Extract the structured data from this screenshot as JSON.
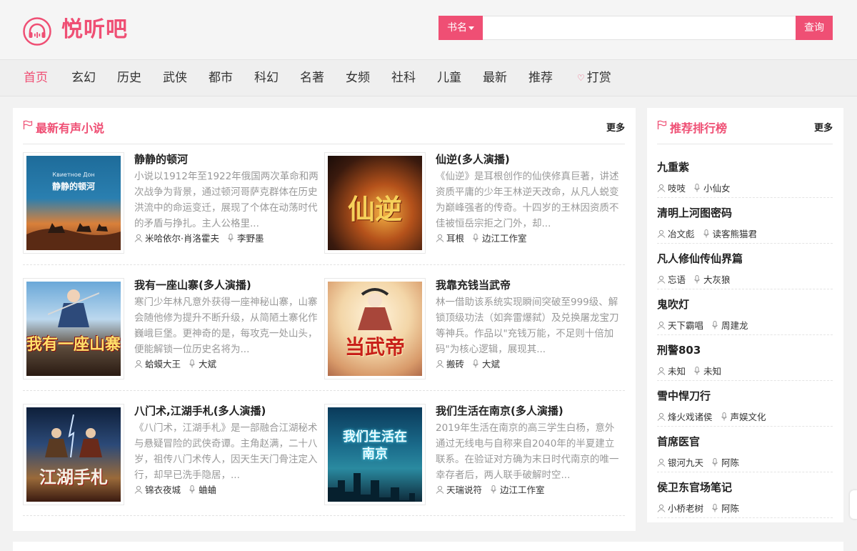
{
  "site": {
    "name": "悦听吧",
    "accent": "#ef4f74"
  },
  "search": {
    "category": "书名",
    "placeholder": "",
    "button": "查询"
  },
  "nav": [
    "首页",
    "玄幻",
    "历史",
    "武侠",
    "都市",
    "科幻",
    "名著",
    "女频",
    "社科",
    "儿童",
    "最新",
    "推荐",
    "打赏"
  ],
  "latest": {
    "title": "最新有声小说",
    "more": "更多",
    "books": [
      {
        "title": "静静的顿河",
        "desc": "小说以1912年至1922年俄国两次革命和两次战争为背景，通过顿河哥萨克群体在历史洪流中的命运变迁，展现了个体在动荡时代的矛盾与挣扎。主人公格里...",
        "author": "米哈依尔·肖洛霍夫",
        "narrator": "李野墨",
        "cover_text": "静静的顿河",
        "cover_small": "Квиетное Дон"
      },
      {
        "title": "仙逆(多人演播)",
        "desc": "《仙逆》是耳根创作的仙侠修真巨著，讲述资质平庸的少年王林逆天改命，从凡人蜕变为巅峰强者的传奇。十四岁的王林因资质不佳被恒岳宗拒之门外，却...",
        "author": "耳根",
        "narrator": "边江工作室",
        "cover_text": "仙逆"
      },
      {
        "title": "我有一座山寨(多人演播)",
        "desc": "寒门少年林凡意外获得一座神秘山寨，山寨会随他修为提升不断升级，从简陋土寨化作巍峨巨堡。更神奇的是，每攻克一处山头，便能解锁一位历史名将为...",
        "author": "蛤蟆大王",
        "narrator": "大斌",
        "cover_text": "我有一座山寨"
      },
      {
        "title": "我靠充钱当武帝",
        "desc": "林一借助该系统实现瞬间突破至999级、解锁顶级功法（如奔雷爆弑）及兑换屠龙宝刀等神兵。作品以\"充钱万能，不足则十倍加码\"为核心逻辑，展现其...",
        "author": "搬砖",
        "narrator": "大斌",
        "cover_text": "当武帝"
      },
      {
        "title": "八门术,江湖手札(多人演播)",
        "desc": "《八门术，江湖手札》是一部融合江湖秘术与悬疑冒险的武侠奇谭。主角赵满，二十八岁，祖传八门术传人，因天生天门骨注定入行，却早已洗手隐居，...",
        "author": "锦衣夜城",
        "narrator": "蛐蛐",
        "cover_text": "江湖手札"
      },
      {
        "title": "我们生活在南京(多人演播)",
        "desc": "2019年生活在南京的高三学生白杨，意外通过无线电与自称来自2040年的半夏建立联系。在验证对方确为末日时代南京的唯一幸存者后，两人联手破解时空...",
        "author": "天瑞说符",
        "narrator": "边江工作室",
        "cover_text": "我们生活在南京"
      }
    ]
  },
  "ranking": {
    "title": "推荐排行榜",
    "more": "更多",
    "items": [
      {
        "title": "九重紫",
        "author": "吱吱",
        "narrator": "小仙女"
      },
      {
        "title": "清明上河图密码",
        "author": "冶文彪",
        "narrator": "读客熊猫君"
      },
      {
        "title": "凡人修仙传仙界篇",
        "author": "忘语",
        "narrator": "大灰狼"
      },
      {
        "title": "鬼吹灯",
        "author": "天下霸唱",
        "narrator": "周建龙"
      },
      {
        "title": "刑警803",
        "author": "未知",
        "narrator": "未知"
      },
      {
        "title": "雪中悍刀行",
        "author": "烽火戏诸侯",
        "narrator": "声娱文化"
      },
      {
        "title": "首席医官",
        "author": "银河九天",
        "narrator": "阿陈"
      },
      {
        "title": "侯卫东官场笔记",
        "author": "小桥老树",
        "narrator": "阿陈"
      }
    ]
  }
}
